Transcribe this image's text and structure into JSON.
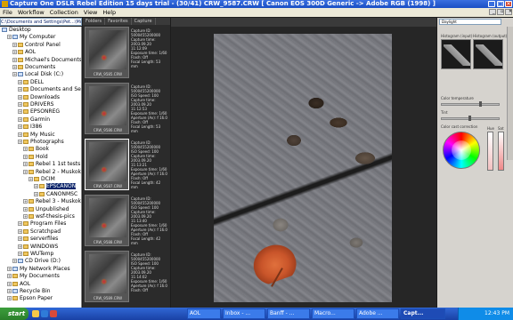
{
  "window": {
    "title": "Capture One DSLR Rebel Edition 15 days trial - (30/41) CRW_9587.CRW [ Canon EOS 300D Generic -> Adobe RGB (1998) ]",
    "controls": [
      "_",
      "□",
      "✕"
    ]
  },
  "menu": [
    "File",
    "Workflow",
    "Collection",
    "View",
    "Help"
  ],
  "path": "C:\\Documents and Settings\\Pet...\\Muskoka\\DCIM\\EPSCANON",
  "tree": [
    {
      "label": "Desktop",
      "indent": 0,
      "icon": "pc"
    },
    {
      "label": "My Computer",
      "indent": 1,
      "icon": "pc"
    },
    {
      "label": "Control Panel",
      "indent": 2,
      "icon": "folder"
    },
    {
      "label": "AOL",
      "indent": 2,
      "icon": "folder"
    },
    {
      "label": "Michael's Documents",
      "indent": 2,
      "icon": "folder"
    },
    {
      "label": "Documents",
      "indent": 2,
      "icon": "folder"
    },
    {
      "label": "Local Disk (C:)",
      "indent": 2,
      "icon": "pc"
    },
    {
      "label": "DELL",
      "indent": 3,
      "icon": "folder"
    },
    {
      "label": "Documents and Settin",
      "indent": 3,
      "icon": "folder"
    },
    {
      "label": "Downloads",
      "indent": 3,
      "icon": "folder"
    },
    {
      "label": "DRIVERS",
      "indent": 3,
      "icon": "folder"
    },
    {
      "label": "EPSONREG",
      "indent": 3,
      "icon": "folder"
    },
    {
      "label": "Garmin",
      "indent": 3,
      "icon": "folder"
    },
    {
      "label": "I386",
      "indent": 3,
      "icon": "folder"
    },
    {
      "label": "My Music",
      "indent": 3,
      "icon": "folder"
    },
    {
      "label": "Photographs",
      "indent": 3,
      "icon": "folder"
    },
    {
      "label": "Book",
      "indent": 4,
      "icon": "folder"
    },
    {
      "label": "Hold",
      "indent": 4,
      "icon": "folder"
    },
    {
      "label": "Rebel 1 1st tests",
      "indent": 4,
      "icon": "folder"
    },
    {
      "label": "Rebel 2 - Muskoka",
      "indent": 4,
      "icon": "folder"
    },
    {
      "label": "DCIM",
      "indent": 5,
      "icon": "folder"
    },
    {
      "label": "EPSCANON",
      "indent": 6,
      "icon": "folder",
      "selected": true
    },
    {
      "label": "CANONMSC",
      "indent": 6,
      "icon": "folder"
    },
    {
      "label": "Rebel 3 - Muskoka",
      "indent": 4,
      "icon": "folder"
    },
    {
      "label": "Unpublished",
      "indent": 4,
      "icon": "folder"
    },
    {
      "label": "wsf-thesis-pics",
      "indent": 4,
      "icon": "folder"
    },
    {
      "label": "Program Files",
      "indent": 3,
      "icon": "folder"
    },
    {
      "label": "Scratchpad",
      "indent": 3,
      "icon": "folder"
    },
    {
      "label": "serverfiles",
      "indent": 3,
      "icon": "folder"
    },
    {
      "label": "WINDOWS",
      "indent": 3,
      "icon": "folder"
    },
    {
      "label": "WUTemp",
      "indent": 3,
      "icon": "folder"
    },
    {
      "label": "CD Drive (D:)",
      "indent": 2,
      "icon": "pc"
    },
    {
      "label": "My Network Places",
      "indent": 1,
      "icon": "pc"
    },
    {
      "label": "My Documents",
      "indent": 1,
      "icon": "folder"
    },
    {
      "label": "AOL",
      "indent": 1,
      "icon": "folder"
    },
    {
      "label": "Recycle Bin",
      "indent": 1,
      "icon": "pc"
    },
    {
      "label": "Epson Paper",
      "indent": 1,
      "icon": "folder"
    }
  ],
  "browser": {
    "tabs": [
      "Folders",
      "Favorites",
      "Capture"
    ],
    "thumbs": [
      {
        "caption": "CRW_9585.CRW",
        "info": [
          "Capture ID:",
          "5000455200000",
          "Capture time:",
          "2003.09.20 11:12:09",
          "Exposure time: 1/60",
          "Flash: Off",
          "Focal Length: 53 mm"
        ]
      },
      {
        "caption": "CRW_9586.CRW",
        "info": [
          "Capture ID:",
          "5000455200000",
          "ISO Speed: 100",
          "Capture time:",
          "2003.09.20 11:12:53",
          "Exposure time: 1/60",
          "Aperture (Av): f 16.0",
          "Flash: Off",
          "Focal Length: 53 mm"
        ]
      },
      {
        "caption": "CRW_9587.CRW",
        "info": [
          "Capture ID:",
          "5000455200000",
          "ISO Speed: 100",
          "Capture time:",
          "2003.09.20 11:13:21",
          "Exposure time: 1/60",
          "Aperture (Av): f 16.0",
          "Flash: Off",
          "Focal Length: 42 mm"
        ]
      },
      {
        "caption": "CRW_9588.CRW",
        "info": [
          "Capture ID:",
          "5000455200000",
          "ISO Speed: 100",
          "Capture time:",
          "2003.09.20 11:13:40",
          "Exposure time: 1/60",
          "Aperture (Av): f 16.0",
          "Flash: Off",
          "Focal Length: 42 mm"
        ]
      },
      {
        "caption": "CRW_9589.CRW",
        "info": [
          "Capture ID:",
          "5000455200000",
          "ISO Speed: 100",
          "Capture time:",
          "2003.09.20 11:14:02",
          "Exposure time: 1/60",
          "Aperture (Av): f 16.0",
          "Flash: Off"
        ]
      }
    ]
  },
  "right_panel": {
    "preset": "Daylight",
    "hist_left": "Histogram (input)",
    "hist_right": "Histogram (output)",
    "labels": [
      "Color temperature",
      "Tint",
      "Color cast correction",
      "Hue",
      "Sat"
    ]
  },
  "taskbar": {
    "start": "start",
    "items": [
      "AOL",
      "Inbox - ...",
      "Banff - ...",
      "Macro...",
      "Adobe ...",
      "Capt..."
    ],
    "active_index": 5,
    "time": "12:43 PM"
  }
}
